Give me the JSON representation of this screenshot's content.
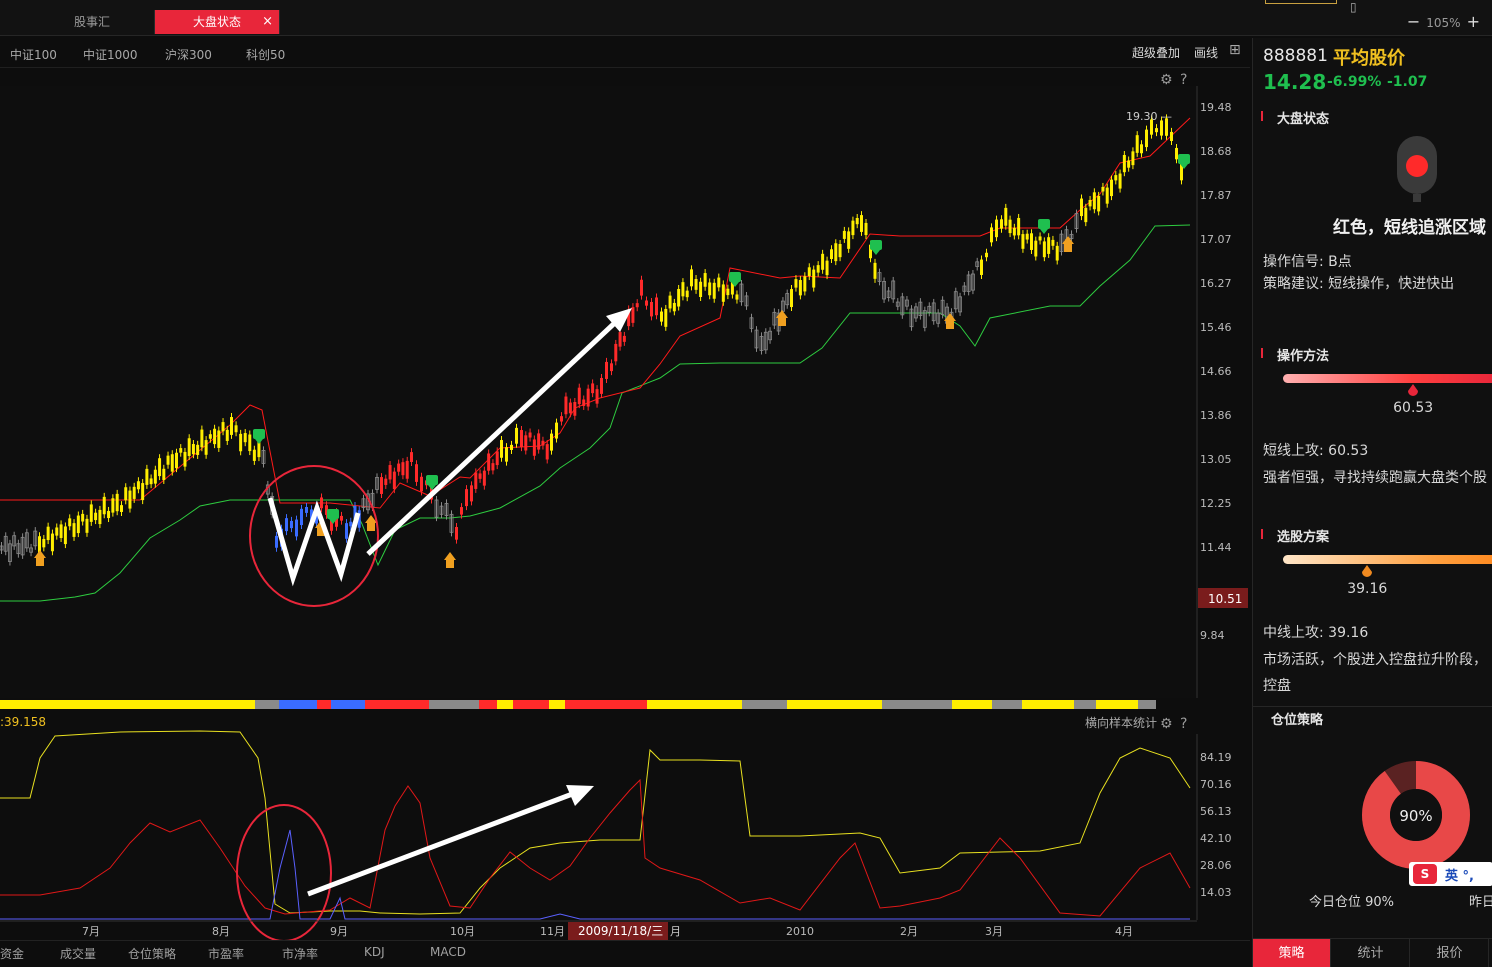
{
  "tabs": {
    "items": [
      "股事汇",
      "大盘状态"
    ],
    "close": "×"
  },
  "zoom": {
    "minus": "−",
    "value": "105%",
    "plus": "+"
  },
  "index_row": {
    "items": [
      "中证100",
      "中证1000",
      "沪深300",
      "科创50"
    ],
    "overlay": "超级叠加",
    "draw": "画线"
  },
  "main_chart": {
    "y_ticks": [
      "19.48",
      "18.68",
      "17.87",
      "17.07",
      "16.27",
      "15.46",
      "14.66",
      "13.86",
      "13.05",
      "12.25",
      "11.44",
      "10.51",
      "9.84"
    ],
    "current_price_label": "10.51",
    "high_label": "19.30",
    "colors": {
      "yellow": "#ffee00",
      "red": "#ff1a1a",
      "green": "#2ecc40",
      "grey": "#7a7a7a",
      "blue": "#4a6cff"
    }
  },
  "status_strip": {
    "color_sequence": [
      "yellow",
      "grey",
      "blue",
      "red",
      "blue",
      "red",
      "grey",
      "red",
      "yellow",
      "red",
      "yellow",
      "red",
      "yellow",
      "grey",
      "yellow",
      "grey",
      "yellow",
      "grey",
      "yellow",
      "grey",
      "yellow",
      "grey"
    ]
  },
  "sub_chart": {
    "value_label": ":39.158",
    "stats_label": "横向样本统计",
    "y_ticks": [
      "84.19",
      "70.16",
      "56.13",
      "42.10",
      "28.06",
      "14.03"
    ]
  },
  "x_axis": {
    "labels": [
      "7月",
      "8月",
      "9月",
      "10月",
      "11月",
      "2010",
      "2月",
      "3月",
      "4月"
    ],
    "cursor_date": "2009/11/18/三",
    "cursor_suffix": "月"
  },
  "bottom_tabs": [
    "资金",
    "成交量",
    "仓位策略",
    "市盈率",
    "市净率",
    "KDJ",
    "MACD"
  ],
  "right_panel": {
    "code": "888881",
    "name": "平均股价",
    "price": "14.28",
    "pct": "-6.99%",
    "change": "-1.07",
    "market_state": {
      "title": "大盘状态",
      "headline": "红色，短线追涨区域",
      "signal": "操作信号: B点",
      "advice": "策略建议: 短线操作，快进快出"
    },
    "method": {
      "title": "操作方法",
      "value": "60.53",
      "value_pct": 0.6053,
      "line1": "短线上攻:  60.53",
      "line2": "强者恒强，寻找持续跑赢大盘类个股"
    },
    "selection": {
      "title": "选股方案",
      "value": "39.16",
      "value_pct": 0.3916,
      "line1": "中线上攻:  39.16",
      "line2": "市场活跃，个股进入控盘拉升阶段，",
      "line3": "控盘"
    },
    "position": {
      "title": "仓位策略",
      "donut_value": "90%",
      "donut_pct": 0.9,
      "today": "今日仓位  90%",
      "yesterday": "昨日",
      "ime": "英 °,"
    },
    "tabs": [
      "策略",
      "统计",
      "报价"
    ]
  }
}
